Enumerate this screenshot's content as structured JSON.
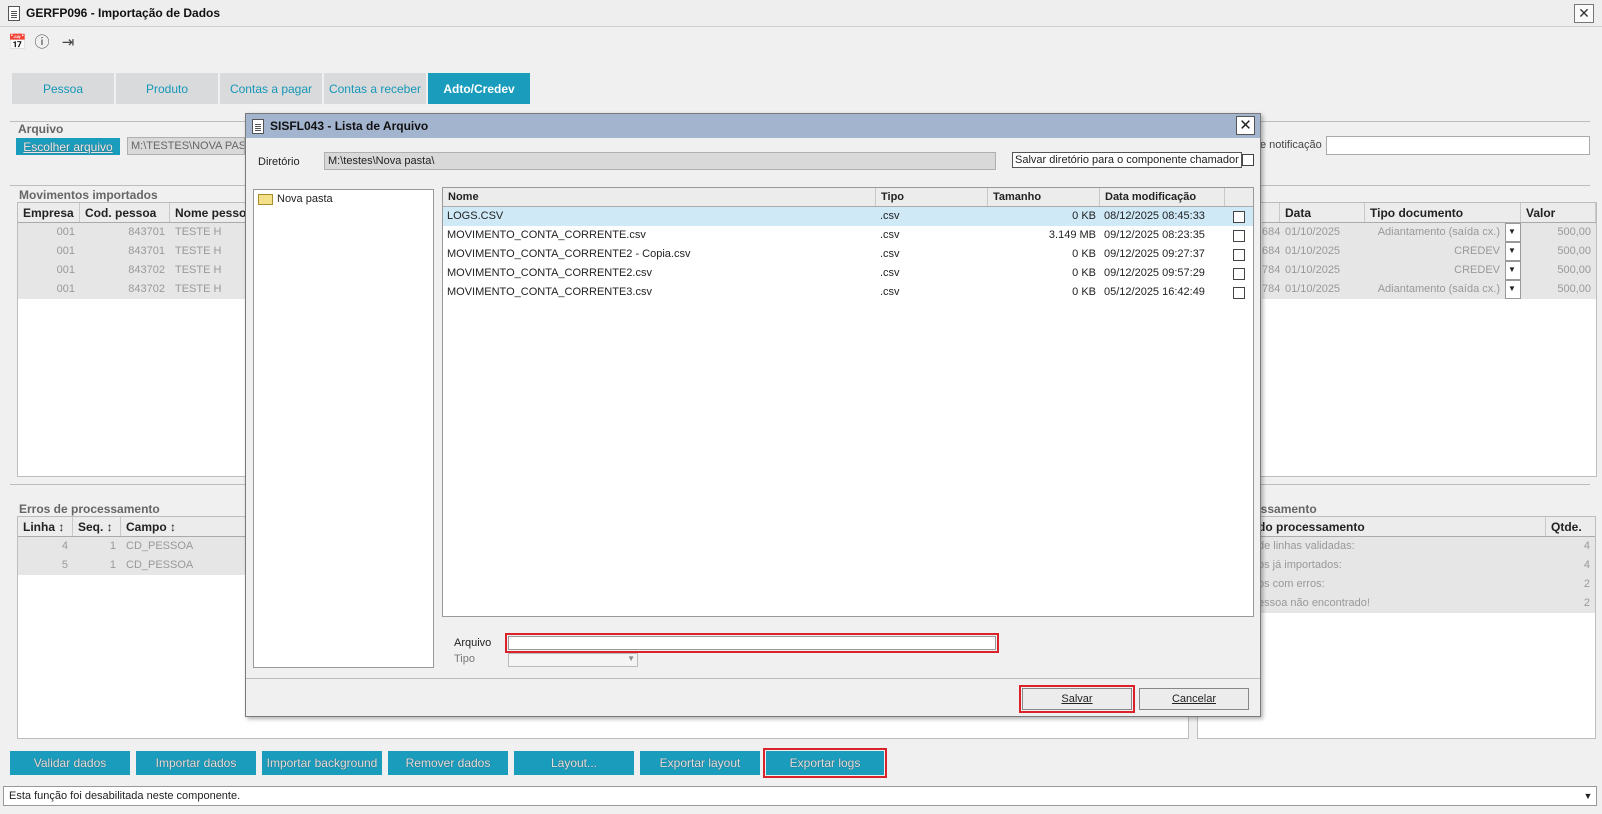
{
  "window": {
    "title": "GERFP096 - Importação de Dados"
  },
  "toolbar": {
    "icons": [
      "calendar-icon",
      "help-icon",
      "exit-icon"
    ]
  },
  "tabs": [
    "Pessoa",
    "Produto",
    "Contas a pagar",
    "Contas a receber",
    "Adto/Credev"
  ],
  "arquivo": {
    "label": "Arquivo",
    "choose_button": "Escolher arquivo",
    "path": "M:\\TESTES\\NOVA PAST",
    "notif_label": "e notificação"
  },
  "movimentos": {
    "title": "Movimentos importados",
    "columns": [
      "Empresa",
      "Cod. pessoa",
      "Nome pessoa"
    ],
    "rows": [
      [
        "001",
        "843701",
        "TESTE H"
      ],
      [
        "001",
        "843701",
        "TESTE H"
      ],
      [
        "001",
        "843702",
        "TESTE H"
      ],
      [
        "001",
        "843702",
        "TESTE H"
      ]
    ],
    "right_columns": [
      "Data",
      "Tipo documento",
      "Valor"
    ],
    "right_rows": [
      [
        "684",
        "01/10/2025",
        "Adiantamento (saída cx.)",
        "500,00"
      ],
      [
        "684",
        "01/10/2025",
        "CREDEV",
        "500,00"
      ],
      [
        "784",
        "01/10/2025",
        "CREDEV",
        "500,00"
      ],
      [
        "784",
        "01/10/2025",
        "Adiantamento (saída cx.)",
        "500,00"
      ]
    ]
  },
  "erros": {
    "title": "Erros de processamento",
    "columns": [
      "Linha ↕",
      "Seq. ↕",
      "Campo ↕"
    ],
    "rows": [
      [
        "4",
        "1",
        "CD_PESSOA"
      ],
      [
        "5",
        "1",
        "CD_PESSOA"
      ]
    ]
  },
  "resumo": {
    "title": "ocessamento",
    "columns": [
      "do processamento",
      "Qtde."
    ],
    "rows": [
      [
        "de linhas validadas:",
        "4"
      ],
      [
        "os já importados:",
        "4"
      ],
      [
        "os com erros:",
        "2"
      ],
      [
        "essoa não encontrado!",
        "2"
      ]
    ]
  },
  "bottom_buttons": [
    "Validar dados",
    "Importar dados",
    "Importar background",
    "Remover dados",
    "Layout...",
    "Exportar layout",
    "Exportar logs"
  ],
  "status": {
    "text": "Esta função foi desabilitada neste componente."
  },
  "dialog": {
    "title": "SISFL043 - Lista de Arquivo",
    "dir_label": "Diretório",
    "dir_value": "M:\\testes\\Nova pasta\\",
    "save_dir_label": "Salvar diretório para o componente chamador",
    "folder": "Nova pasta",
    "columns": [
      "Nome",
      "Tipo",
      "Tamanho",
      "Data modificação"
    ],
    "files": [
      {
        "name": "LOGS.CSV",
        "type": ".csv",
        "size": "0 KB",
        "date": "08/12/2025 08:45:33"
      },
      {
        "name": "MOVIMENTO_CONTA_CORRENTE.csv",
        "type": ".csv",
        "size": "3.149 MB",
        "date": "09/12/2025 08:23:35"
      },
      {
        "name": "MOVIMENTO_CONTA_CORRENTE2 - Copia.csv",
        "type": ".csv",
        "size": "0 KB",
        "date": "09/12/2025 09:27:37"
      },
      {
        "name": "MOVIMENTO_CONTA_CORRENTE2.csv",
        "type": ".csv",
        "size": "0 KB",
        "date": "09/12/2025 09:57:29"
      },
      {
        "name": "MOVIMENTO_CONTA_CORRENTE3.csv",
        "type": ".csv",
        "size": "0 KB",
        "date": "05/12/2025 16:42:49"
      }
    ],
    "arquivo_label": "Arquivo",
    "arquivo_value": "",
    "tipo_label": "Tipo",
    "save_button": "Salvar",
    "cancel_button": "Cancelar"
  },
  "colors": {
    "accent": "#1a9cbd",
    "dialog_title": "#a3b4cf",
    "highlight": "#d9232a",
    "selected_row": "#cfe9f7"
  }
}
